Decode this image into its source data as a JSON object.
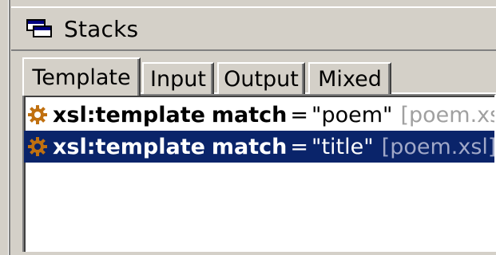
{
  "panel": {
    "title": "Stacks",
    "icon": "stacks-icon"
  },
  "tabs": [
    {
      "label": "Template",
      "active": true
    },
    {
      "label": "Input",
      "active": false
    },
    {
      "label": "Output",
      "active": false
    },
    {
      "label": "Mixed",
      "active": false
    }
  ],
  "stack_items": [
    {
      "icon": "gear-icon",
      "element": "xsl:template",
      "attr": "match",
      "eq": "=",
      "value": "\"poem\"",
      "file": "[poem.xsl]",
      "selected": false
    },
    {
      "icon": "gear-icon",
      "element": "xsl:template",
      "attr": "match",
      "eq": "=",
      "value": "\"title\"",
      "file": "[poem.xsl]",
      "selected": true
    }
  ],
  "colors": {
    "selection": "#0a246a",
    "gear": "#c07010",
    "file_text": "#a0a0a0"
  }
}
